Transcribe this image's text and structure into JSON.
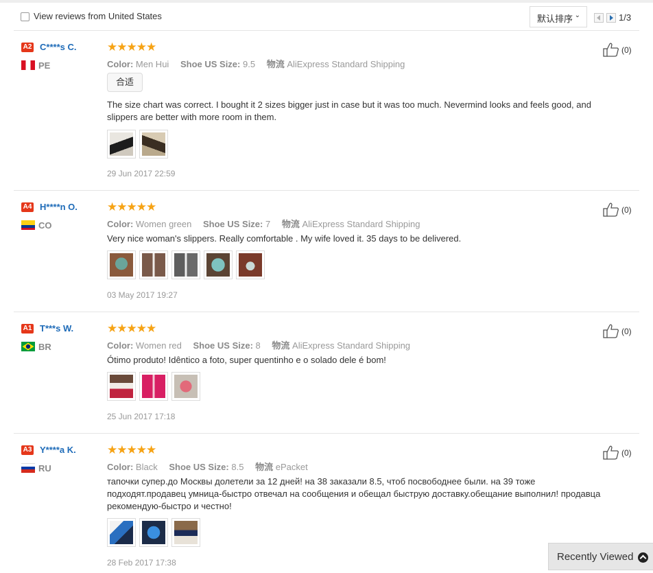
{
  "filter": {
    "label": "View reviews from United States",
    "checked": false
  },
  "sort": {
    "selected": "默认排序"
  },
  "pager": {
    "text": "1/3"
  },
  "labels": {
    "color": "Color:",
    "shoe_size": "Shoe US Size:",
    "shipping": "物流"
  },
  "reviews": [
    {
      "badge": "A2",
      "user": "C****s C.",
      "country": "PE",
      "flag": "pe-flag-icon",
      "rating": 5,
      "stars": "★★★★★",
      "color": "Men Hui",
      "shoe_size": "9.5",
      "shipping": "AliExpress Standard Shipping",
      "tag": "合适",
      "text": "The size chart was correct. I bought it 2 sizes bigger just in case but it was too much. Nevermind looks and feels good, and slippers are better with more room in them.",
      "images": [
        "photo-thumbnail",
        "photo-thumbnail"
      ],
      "date": "29 Jun 2017 22:59",
      "likes": "(0)"
    },
    {
      "badge": "A4",
      "user": "H****n O.",
      "country": "CO",
      "flag": "co-flag-icon",
      "rating": 5,
      "stars": "★★★★★",
      "color": "Women green",
      "shoe_size": "7",
      "shipping": "AliExpress Standard Shipping",
      "text": "Very nice woman's slippers. Really comfortable . My wife loved it. 35 days to be delivered.",
      "images": [
        "photo-thumbnail",
        "photo-thumbnail",
        "photo-thumbnail",
        "photo-thumbnail",
        "photo-thumbnail"
      ],
      "date": "03 May 2017 19:27",
      "likes": "(0)"
    },
    {
      "badge": "A1",
      "user": "T***s W.",
      "country": "BR",
      "flag": "br-flag-icon",
      "rating": 5,
      "stars": "★★★★★",
      "color": "Women red",
      "shoe_size": "8",
      "shipping": "AliExpress Standard Shipping",
      "text": "Ótimo produto! Idêntico a foto, super quentinho e o solado dele é bom!",
      "images": [
        "photo-thumbnail",
        "photo-thumbnail",
        "photo-thumbnail"
      ],
      "date": "25 Jun 2017 17:18",
      "likes": "(0)"
    },
    {
      "badge": "A3",
      "user": "Y****a K.",
      "country": "RU",
      "flag": "ru-flag-icon",
      "rating": 5,
      "stars": "★★★★★",
      "color": "Black",
      "shoe_size": "8.5",
      "shipping": "ePacket",
      "text": "тапочки супер.до Москвы долетели за 12 дней! на 38 заказали 8.5, чтоб посвободнее были. на 39 тоже подходят.продавец умница-быстро отвечал на сообщения и обещал быструю доставку.обещание выполнил! продавца рекомендую-быстро и честно!",
      "images": [
        "photo-thumbnail",
        "photo-thumbnail",
        "photo-thumbnail"
      ],
      "date": "28 Feb 2017 17:38",
      "likes": "(0)"
    }
  ],
  "recently_viewed": {
    "label": "Recently Viewed"
  }
}
